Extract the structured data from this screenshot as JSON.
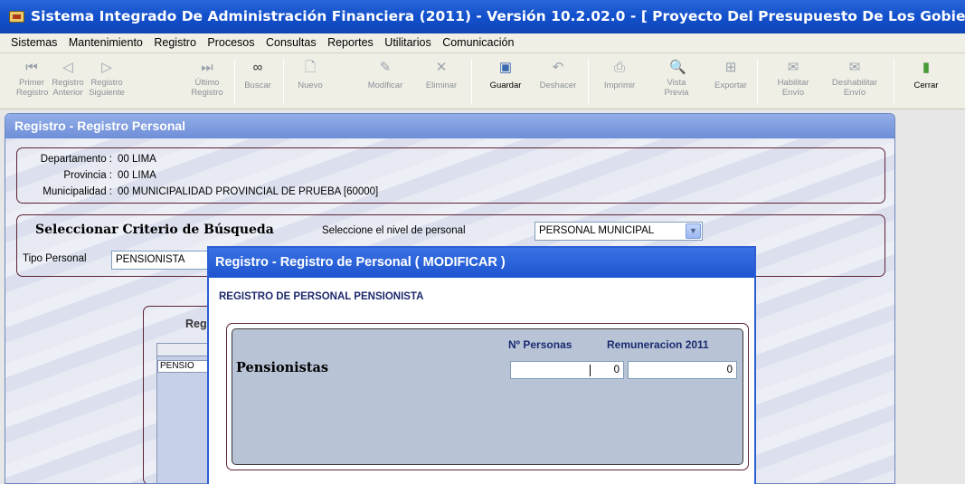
{
  "title": "Sistema Integrado De Administración Financiera (2011) - Versión 10.2.02.0 - [ Proyecto Del Presupuesto De Los Gobierno Lo",
  "menu": [
    "Sistemas",
    "Mantenimiento",
    "Registro",
    "Procesos",
    "Consultas",
    "Reportes",
    "Utilitarios",
    "Comunicación"
  ],
  "toolbar": {
    "primer": [
      "Primer",
      "Registro"
    ],
    "anterior": [
      "Registro",
      "Anterior"
    ],
    "siguiente": [
      "Registro",
      "Siguiente"
    ],
    "ultimo": [
      "Último",
      "Registro"
    ],
    "buscar": "Buscar",
    "nuevo": "Nuevo",
    "modificar": "Modificar",
    "eliminar": "Eliminar",
    "guardar": "Guardar",
    "deshacer": "Deshacer",
    "imprimir": "Imprimir",
    "vista": [
      "Vista",
      "Previa"
    ],
    "exportar": "Exportar",
    "habilitar": [
      "Habilitar",
      "Envío"
    ],
    "deshabilitar": [
      "Deshabilitar",
      "Envío"
    ],
    "cerrar": "Cerrar"
  },
  "panel": {
    "title": "Registro - Registro Personal",
    "departamento_label": "Departamento :",
    "departamento_value": "00  LIMA",
    "provincia_label": "Provincia :",
    "provincia_value": "00  LIMA",
    "municipalidad_label": "Municipalidad :",
    "municipalidad_value": "00  MUNICIPALIDAD PROVINCIAL DE PRUEBA [60000]",
    "criterio_title": "Seleccionar Criterio de Búsqueda",
    "nivel_label": "Seleccione el nivel de personal",
    "nivel_value": "PERSONAL MUNICIPAL",
    "tipo_label": "Tipo Personal",
    "tipo_value": "PENSIONISTA",
    "reg_label": "Reg",
    "grid_cell": "PENSIO"
  },
  "modal": {
    "title": "Registro - Registro de Personal ( MODIFICAR )",
    "subtitle": "REGISTRO DE PERSONAL PENSIONISTA",
    "col_personas": "Nº Personas",
    "col_remuneracion": "Remuneracion 2011",
    "row_label": "Pensionistas",
    "personas_value": "0",
    "remuneracion_value": "0"
  },
  "icons": [
    "first-record-icon",
    "previous-record-icon",
    "next-record-icon",
    "last-record-icon",
    "binoculars-icon",
    "new-document-icon",
    "edit-icon",
    "delete-icon",
    "save-icon",
    "undo-icon",
    "print-icon",
    "preview-icon",
    "export-icon",
    "enable-send-icon",
    "disable-send-icon",
    "exit-icon"
  ]
}
